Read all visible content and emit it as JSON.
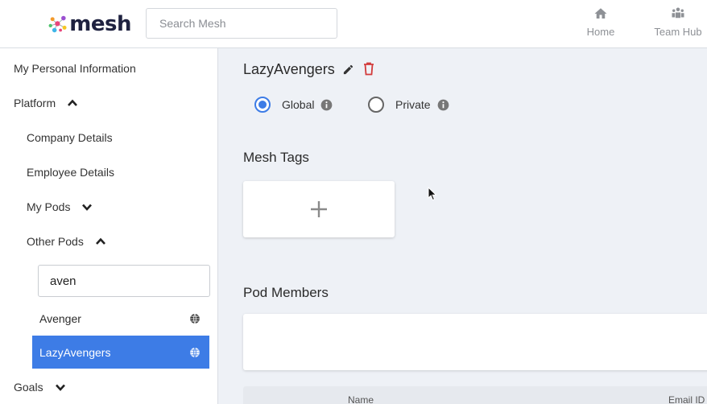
{
  "header": {
    "logo_text": "mesh",
    "search_placeholder": "Search Mesh",
    "nav": [
      {
        "label": "Home",
        "icon": "home-icon"
      },
      {
        "label": "Team Hub",
        "icon": "team-icon"
      }
    ]
  },
  "sidebar": {
    "personal_info": "My Personal Information",
    "platform": "Platform",
    "company_details": "Company Details",
    "employee_details": "Employee Details",
    "my_pods": "My Pods",
    "other_pods": "Other Pods",
    "pod_search_value": "aven",
    "pods": [
      {
        "label": "Avenger",
        "icon": "globe-icon",
        "active": false
      },
      {
        "label": "LazyAvengers",
        "icon": "globe-icon",
        "active": true
      }
    ],
    "goals": "Goals"
  },
  "main": {
    "pod_title": "LazyAvengers",
    "visibility": {
      "options": [
        {
          "label": "Global",
          "selected": true
        },
        {
          "label": "Private",
          "selected": false
        }
      ]
    },
    "mesh_tags_title": "Mesh Tags",
    "pod_members_title": "Pod Members",
    "table_columns": [
      "Name",
      "Email ID"
    ]
  },
  "colors": {
    "accent": "#3d7ce6",
    "delete": "#d23b3b",
    "icon_gray": "#8e9196",
    "background": "#eef1f6"
  }
}
